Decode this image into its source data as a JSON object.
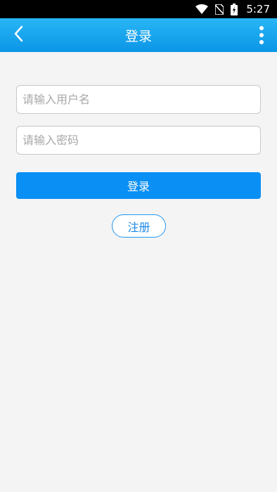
{
  "status_bar": {
    "time": "5:27",
    "icons": [
      "wifi-icon",
      "no-sim-icon",
      "battery-charging-icon"
    ]
  },
  "app_bar": {
    "title": "登录",
    "back_icon": "back-arrow-icon",
    "menu_icon": "more-vertical-icon"
  },
  "form": {
    "username_placeholder": "请输入用户名",
    "username_value": "",
    "password_placeholder": "请输入密码",
    "password_value": "",
    "login_label": "登录",
    "register_label": "注册"
  },
  "colors": {
    "app_bar_top": "#29b6f6",
    "app_bar_bottom": "#0b95e6",
    "primary_button": "#0a8ff5",
    "register_border": "#2196f3",
    "background": "#f4f4f4"
  }
}
